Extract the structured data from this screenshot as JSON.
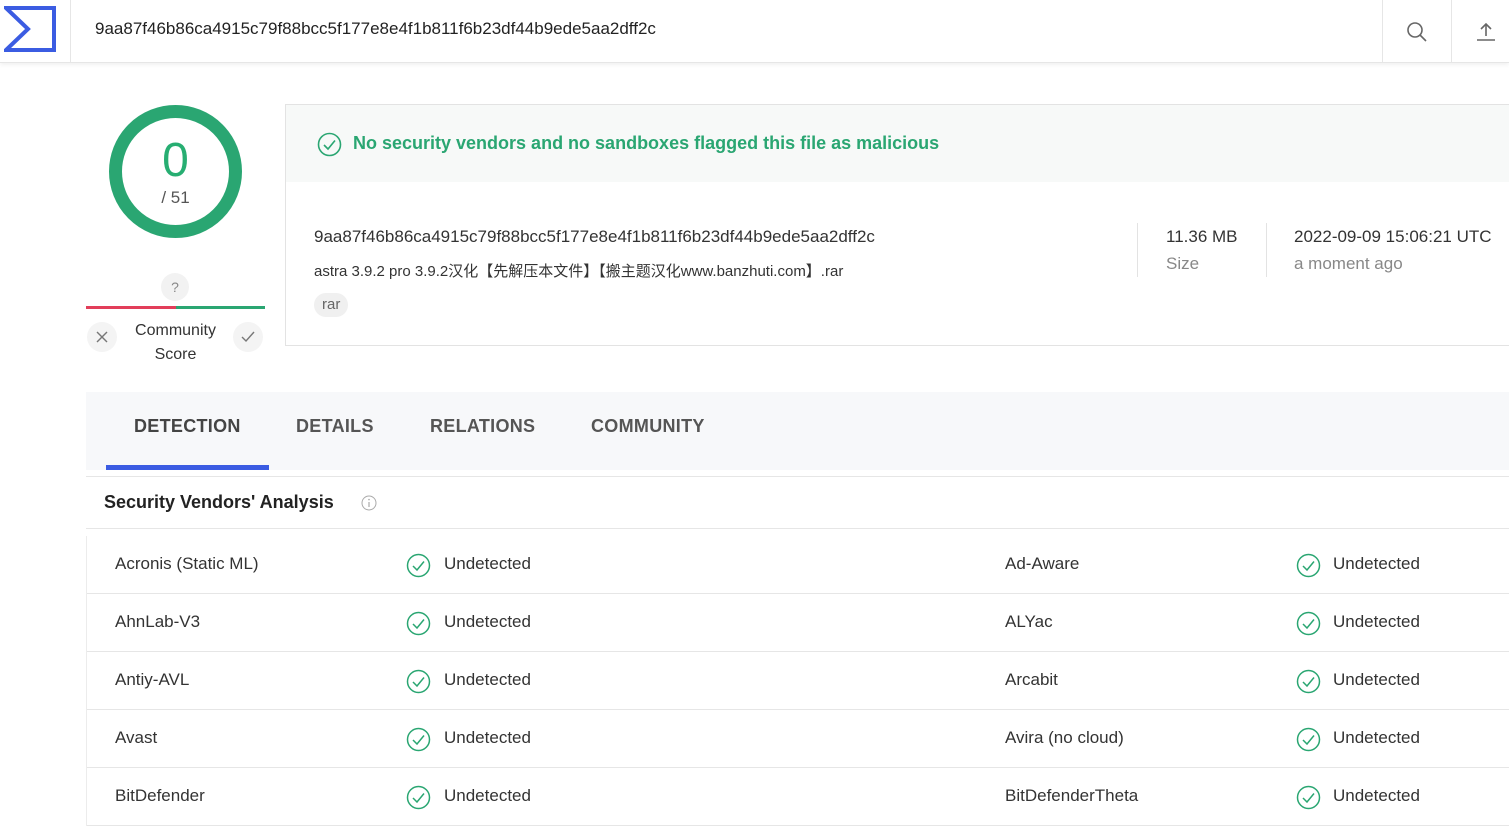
{
  "search": {
    "value": "9aa87f46b86ca4915c79f88bcc5f177e8e4f1b811f6b23df44b9ede5aa2dff2c"
  },
  "score": {
    "detections": "0",
    "total": "/ 51",
    "community_badge": "?",
    "community_label_line1": "Community",
    "community_label_line2": "Score"
  },
  "summary": {
    "banner": "No security vendors and no sandboxes flagged this file as malicious",
    "hash": "9aa87f46b86ca4915c79f88bcc5f177e8e4f1b811f6b23df44b9ede5aa2dff2c",
    "filename": "astra 3.9.2 pro 3.9.2汉化【先解压本文件】【搬主题汉化www.banzhuti.com】.rar",
    "tag": "rar",
    "size_value": "11.36 MB",
    "size_label": "Size",
    "date_value": "2022-09-09 15:06:21 UTC",
    "date_relative": "a moment ago"
  },
  "tabs": [
    "DETECTION",
    "DETAILS",
    "RELATIONS",
    "COMMUNITY"
  ],
  "section": {
    "title": "Security Vendors' Analysis"
  },
  "vendors": [
    {
      "left": {
        "name": "Acronis (Static ML)",
        "result": "Undetected"
      },
      "right": {
        "name": "Ad-Aware",
        "result": "Undetected"
      }
    },
    {
      "left": {
        "name": "AhnLab-V3",
        "result": "Undetected"
      },
      "right": {
        "name": "ALYac",
        "result": "Undetected"
      }
    },
    {
      "left": {
        "name": "Antiy-AVL",
        "result": "Undetected"
      },
      "right": {
        "name": "Arcabit",
        "result": "Undetected"
      }
    },
    {
      "left": {
        "name": "Avast",
        "result": "Undetected"
      },
      "right": {
        "name": "Avira (no cloud)",
        "result": "Undetected"
      }
    },
    {
      "left": {
        "name": "BitDefender",
        "result": "Undetected"
      },
      "right": {
        "name": "BitDefenderTheta",
        "result": "Undetected"
      }
    }
  ],
  "colors": {
    "accent_green": "#2aa672",
    "alert_red": "#e23e5a",
    "brand_blue": "#3b5ce2"
  },
  "icons": {
    "logo": "virustotal-logo-icon",
    "search": "search-icon",
    "upload": "upload-icon",
    "check": "check-circle-icon",
    "info": "info-icon"
  }
}
